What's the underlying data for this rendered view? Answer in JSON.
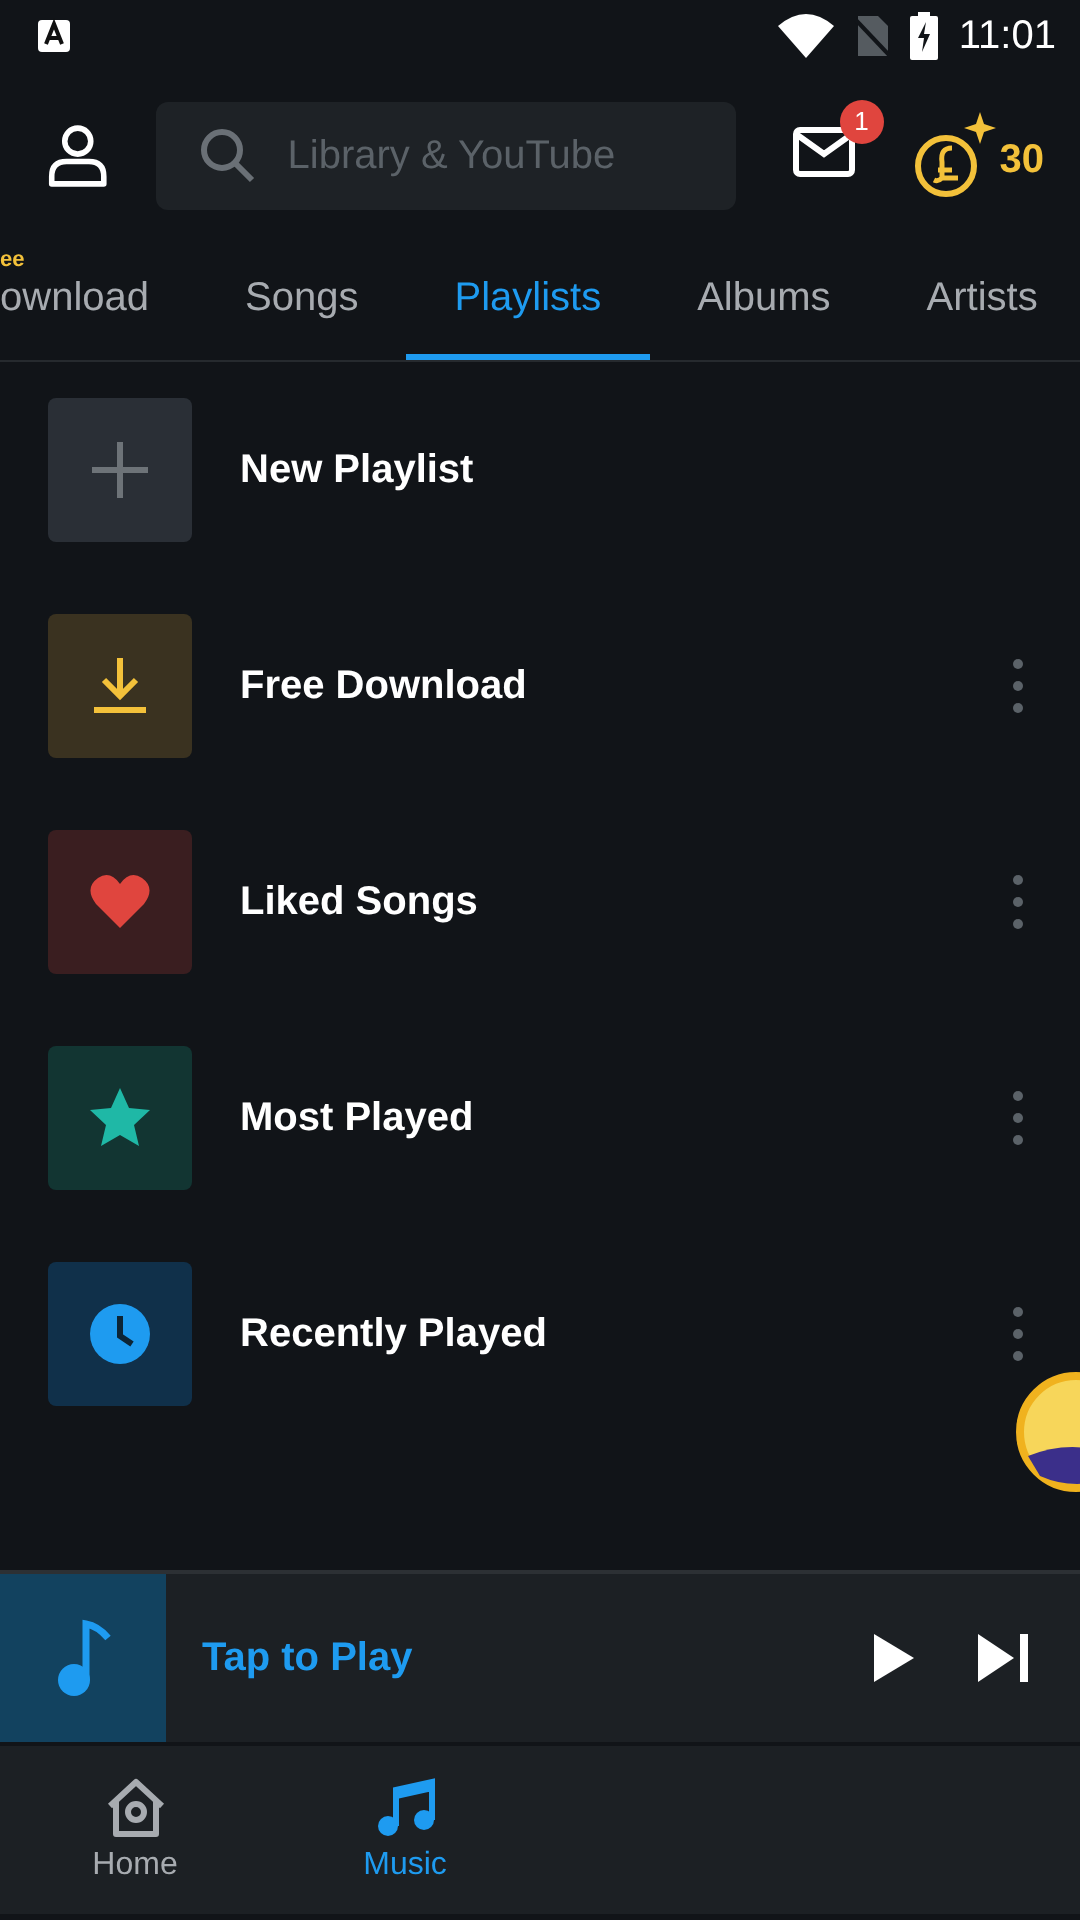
{
  "status_bar": {
    "time": "11:01"
  },
  "header": {
    "search": {
      "placeholder": "Library & YouTube"
    },
    "mail_badge": "1",
    "coins": "30"
  },
  "tabs": [
    {
      "label": "ownload",
      "badge": "ee",
      "selected": false
    },
    {
      "label": "Songs",
      "selected": false
    },
    {
      "label": "Playlists",
      "selected": true
    },
    {
      "label": "Albums",
      "selected": false
    },
    {
      "label": "Artists",
      "selected": false
    }
  ],
  "playlists": [
    {
      "kind": "add",
      "title": "New Playlist",
      "color": "#2a2f36"
    },
    {
      "kind": "download",
      "title": "Free Download",
      "color": "#3a3220"
    },
    {
      "kind": "liked",
      "title": "Liked Songs",
      "color": "#3a1e20"
    },
    {
      "kind": "most",
      "title": "Most Played",
      "color": "#123532"
    },
    {
      "kind": "recent",
      "title": "Recently Played",
      "color": "#10304a"
    }
  ],
  "mini_player": {
    "title": "Tap to Play"
  },
  "bottom_nav": [
    {
      "kind": "home",
      "label": "Home",
      "selected": false
    },
    {
      "kind": "music",
      "label": "Music",
      "selected": true
    }
  ]
}
